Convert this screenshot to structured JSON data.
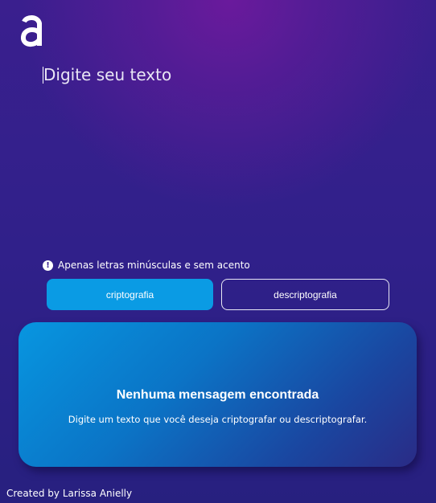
{
  "app": {
    "logo_icon": "alura-a-logo-icon"
  },
  "input": {
    "placeholder": "Digite seu texto",
    "value": ""
  },
  "warning": {
    "icon": "exclamation-circle-icon",
    "text": "Apenas letras minúsculas e sem acento"
  },
  "actions": {
    "encrypt_label": "criptografia",
    "decrypt_label": "descriptografia",
    "encrypt_color": "#0a9be4"
  },
  "output": {
    "title": "Nenhuma mensagem encontrada",
    "message": "Digite um texto que você deseja criptografar ou descriptografar."
  },
  "footer": {
    "credit": "Created by Larissa Anielly"
  }
}
